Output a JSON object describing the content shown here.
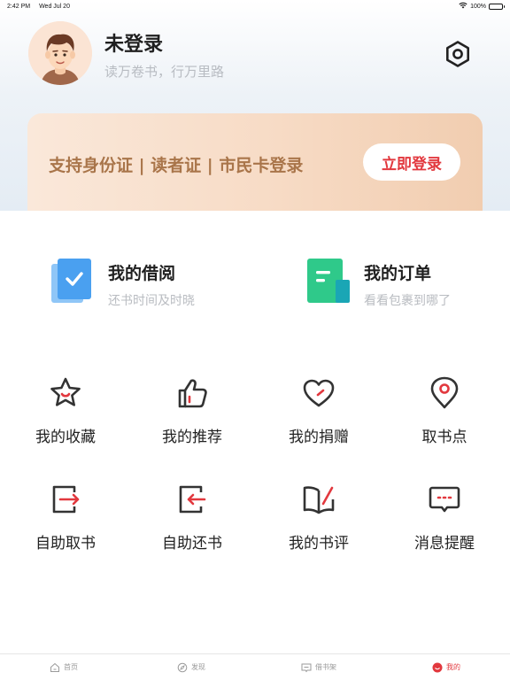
{
  "status_bar": {
    "time": "2:42 PM",
    "date": "Wed Jul 20",
    "battery": "100%"
  },
  "profile": {
    "name": "未登录",
    "slogan": "读万卷书，行万里路"
  },
  "login_banner": {
    "tip": "支持身份证 | 读者证 | 市民卡登录",
    "button": "立即登录"
  },
  "features": [
    {
      "title": "我的借阅",
      "subtitle": "还书时间及时晓",
      "icon": "borrow-book-icon"
    },
    {
      "title": "我的订单",
      "subtitle": "看看包裹到哪了",
      "icon": "order-document-icon"
    }
  ],
  "grid": [
    {
      "label": "我的收藏",
      "icon": "star-icon"
    },
    {
      "label": "我的推荐",
      "icon": "thumbs-up-icon"
    },
    {
      "label": "我的捐赠",
      "icon": "heart-icon"
    },
    {
      "label": "取书点",
      "icon": "location-pin-icon"
    },
    {
      "label": "自助取书",
      "icon": "self-pickup-icon"
    },
    {
      "label": "自助还书",
      "icon": "self-return-icon"
    },
    {
      "label": "我的书评",
      "icon": "book-review-icon"
    },
    {
      "label": "消息提醒",
      "icon": "message-icon"
    }
  ],
  "tabs": [
    {
      "label": "首页",
      "icon": "home-icon",
      "active": false
    },
    {
      "label": "发现",
      "icon": "compass-icon",
      "active": false
    },
    {
      "label": "借书架",
      "icon": "bookshelf-icon",
      "active": false
    },
    {
      "label": "我的",
      "icon": "profile-icon",
      "active": true
    }
  ],
  "colors": {
    "accent": "#e2383e",
    "banner_text": "#a9754a",
    "borrow_icon": "#4aa0f0",
    "order_icon": "#2fc98a"
  }
}
